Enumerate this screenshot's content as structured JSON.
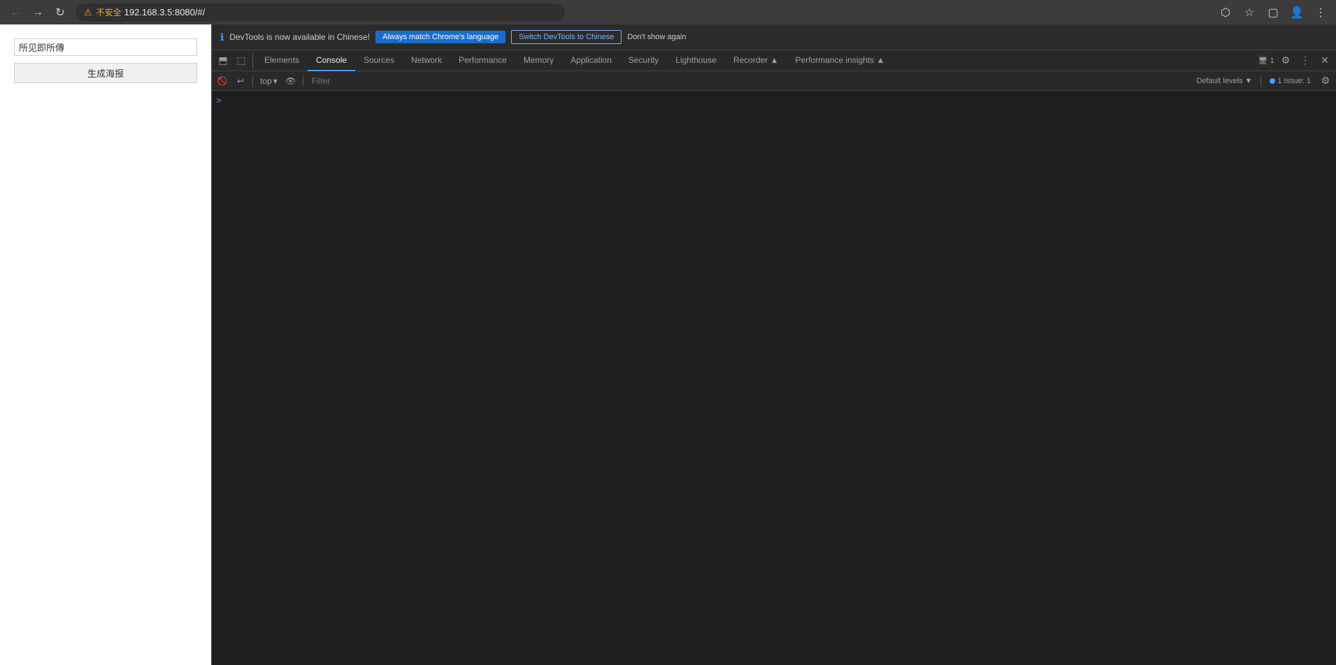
{
  "browser": {
    "url": "192.168.3.5:8080/#/",
    "insecure_label": "不安全",
    "nav": {
      "back_label": "←",
      "forward_label": "→",
      "reload_label": "↻"
    },
    "actions": {
      "cast": "⬡",
      "bookmark": "☆",
      "window": "▢",
      "profile": "👤",
      "menu": "⋮"
    }
  },
  "webpage": {
    "input_placeholder": "所见即所傳",
    "button_label": "生成海报"
  },
  "notification": {
    "icon": "ℹ",
    "text": "DevTools is now available in Chinese!",
    "btn_match": "Always match Chrome's language",
    "btn_switch": "Switch DevTools to Chinese",
    "btn_dismiss": "Don't show again"
  },
  "devtools": {
    "tabs": [
      {
        "id": "elements",
        "label": "Elements",
        "active": false
      },
      {
        "id": "console",
        "label": "Console",
        "active": true
      },
      {
        "id": "sources",
        "label": "Sources",
        "active": false
      },
      {
        "id": "network",
        "label": "Network",
        "active": false
      },
      {
        "id": "performance",
        "label": "Performance",
        "active": false
      },
      {
        "id": "memory",
        "label": "Memory",
        "active": false
      },
      {
        "id": "application",
        "label": "Application",
        "active": false
      },
      {
        "id": "security",
        "label": "Security",
        "active": false
      },
      {
        "id": "lighthouse",
        "label": "Lighthouse",
        "active": false
      },
      {
        "id": "recorder",
        "label": "Recorder ▲",
        "active": false
      },
      {
        "id": "performance-insights",
        "label": "Performance insights ▲",
        "active": false
      }
    ],
    "issues_label": "1 Issue:",
    "issues_count": "1"
  },
  "console": {
    "top_label": "top",
    "filter_placeholder": "Filter",
    "default_levels_label": "Default levels ▼",
    "prompt_char": ">"
  }
}
